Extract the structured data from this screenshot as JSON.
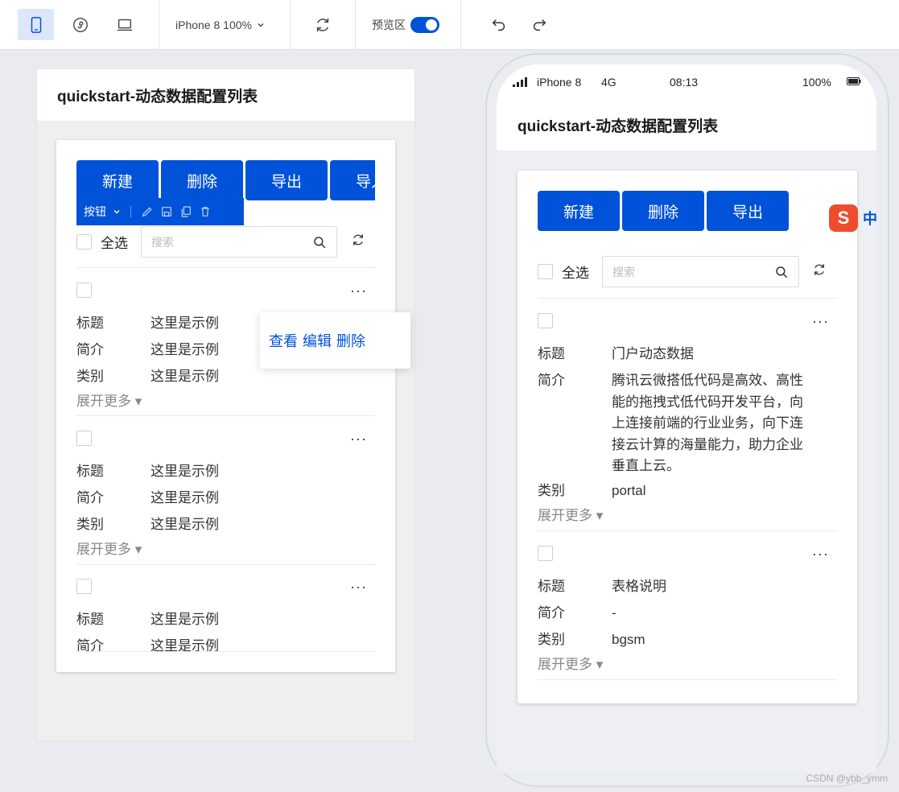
{
  "toolbar": {
    "device_label": "iPhone 8 100%",
    "preview_label": "预览区",
    "preview_on": true
  },
  "page_title": "quickstart-动态数据配置列表",
  "buttons": {
    "new": "新建",
    "delete": "删除",
    "export": "导出",
    "import": "导入"
  },
  "selection_bar": {
    "label": "按钮"
  },
  "select_all": "全选",
  "search_placeholder": "搜索",
  "popover": {
    "view": "查看",
    "edit": "编辑",
    "delete": "删除"
  },
  "field_labels": {
    "title": "标题",
    "intro": "简介",
    "category": "类别"
  },
  "expand_label": "展开更多",
  "more_glyph": "···",
  "left_items": [
    {
      "title": "这里是示例",
      "intro": "这里是示例",
      "category": "这里是示例"
    },
    {
      "title": "这里是示例",
      "intro": "这里是示例",
      "category": "这里是示例"
    },
    {
      "title": "这里是示例",
      "intro": "这里是示例"
    }
  ],
  "phone": {
    "carrier": "iPhone 8",
    "network": "4G",
    "time": "08:13",
    "battery": "100%",
    "items": [
      {
        "title": "门户动态数据",
        "intro": "腾讯云微搭低代码是高效、高性能的拖拽式低代码开发平台，向上连接前端的行业业务，向下连接云计算的海量能力，助力企业垂直上云。",
        "category": "portal"
      },
      {
        "title": "表格说明",
        "intro": "-",
        "category": "bgsm"
      }
    ]
  },
  "ime": {
    "glyph": "S",
    "mode": "中"
  },
  "watermark": "CSDN @ybb_ymm",
  "colors": {
    "primary": "#0052d9",
    "ime": "#ee4d2d"
  }
}
